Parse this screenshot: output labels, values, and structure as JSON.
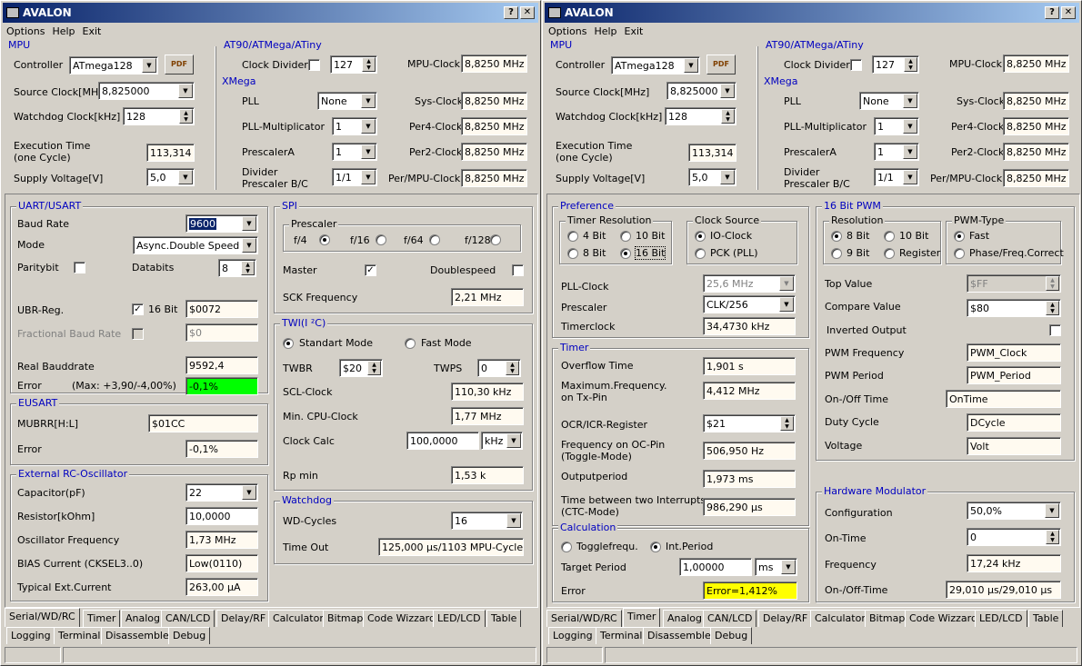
{
  "app": {
    "title": "AVALON",
    "help_btn": "?",
    "close_btn": "✕"
  },
  "menu": [
    "Options",
    "Help",
    "Exit"
  ],
  "mpu": {
    "title": "MPU",
    "controller_label": "Controller",
    "controller": "ATmega128",
    "source_clock_label": "Source Clock[MHz]",
    "source_clock": "8,825000",
    "watchdog_clock_label": "Watchdog Clock[kHz]",
    "watchdog_clock": "128",
    "exec_time_label1": "Execution Time",
    "exec_time_label2": "(one Cycle)",
    "exec_time": "113,314",
    "supply_label": "Supply Voltage[V]",
    "supply": "5,0"
  },
  "at90": {
    "title": "AT90/ATMega/ATiny",
    "clock_divider_label": "Clock Divider",
    "clock_divider": "127",
    "mpu_clock_label": "MPU-Clock",
    "mpu_clock": "8,8250 MHz"
  },
  "xmega": {
    "title": "XMega",
    "pll_label": "PLL",
    "pll": "None",
    "sys_clock_label": "Sys-Clock",
    "sys_clock": "8,8250 MHz",
    "pll_mult_label": "PLL-Multiplicator",
    "pll_mult": "1",
    "per4_label": "Per4-Clock",
    "per4": "8,8250 MHz",
    "prescalerA_label": "PrescalerA",
    "prescalerA": "1",
    "per2_label": "Per2-Clock",
    "per2": "8,8250 MHz",
    "divider_label1": "Divider",
    "divider_label2": "Prescaler B/C",
    "divider": "1/1",
    "permpu_label": "Per/MPU-Clock",
    "permpu": "8,8250 MHz"
  },
  "uart": {
    "title": "UART/USART",
    "baud_label": "Baud Rate",
    "baud": "9600",
    "mode_label": "Mode",
    "mode": "Async.Double Speed",
    "parity_label": "Paritybit",
    "databits_label": "Databits",
    "databits": "8",
    "ubr_label": "UBR-Reg.",
    "bit16_label": "16 Bit",
    "ubr": "$0072",
    "frac_label": "Fractional Baud Rate",
    "frac": "$0",
    "real_label": "Real Bauddrate",
    "real": "9592,4",
    "error_label": "Error",
    "error_range": "(Max: +3,90/-4,00%)",
    "error": "-0,1%"
  },
  "eusart": {
    "title": "EUSART",
    "mubrr_label": "MUBRR[H:L]",
    "mubrr": "$01CC",
    "error_label": "Error",
    "error": "-0,1%"
  },
  "rc": {
    "title": "External RC-Oscillator",
    "cap_label": "Capacitor(pF)",
    "cap": "22",
    "res_label": "Resistor[kOhm]",
    "res": "10,0000",
    "osc_label": "Oscillator Frequency",
    "osc": "1,73 MHz",
    "bias_label": "BIAS Current (CKSEL3..0)",
    "bias": "Low(0110)",
    "typ_label": "Typical Ext.Current",
    "typ": "263,00 µA"
  },
  "spi": {
    "title": "SPI",
    "prescaler_label": "Prescaler",
    "opts": [
      "f/4",
      "f/16",
      "f/64",
      "f/128"
    ],
    "master_label": "Master",
    "doublespeed_label": "Doublespeed",
    "sck_label": "SCK Frequency",
    "sck": "2,21 MHz"
  },
  "twi": {
    "title": "TWI(I ²C)",
    "std": "Standart Mode",
    "fast": "Fast Mode",
    "twbr_label": "TWBR",
    "twbr": "$20",
    "twps_label": "TWPS",
    "twps": "0",
    "scl_label": "SCL-Clock",
    "scl": "110,30 kHz",
    "mincpu_label": "Min. CPU-Clock",
    "mincpu": "1,77 MHz",
    "calc_label": "Clock Calc",
    "calc": "100,0000",
    "calc_unit": "kHz",
    "rp_label": "Rp min",
    "rp": "1,53 k"
  },
  "wd": {
    "title": "Watchdog",
    "cycles_label": "WD-Cycles",
    "cycles": "16",
    "timeout_label": "Time Out",
    "timeout": "125,000 µs/1103 MPU-Cycles"
  },
  "tabs_row1": [
    "Serial/WD/RC",
    "Timer",
    "Analog",
    "CAN/LCD",
    "Delay/RF",
    "Calculator",
    "Bitmap",
    "Code Wizzard",
    "LED/LCD",
    "Table"
  ],
  "tabs_row2": [
    "Logging",
    "Terminal",
    "Disassembler",
    "Debug"
  ],
  "pref": {
    "title": "Preference",
    "res_title": "Timer Resolution",
    "res_opts": [
      "4 Bit",
      "10 Bit",
      "8 Bit",
      "16 Bit"
    ],
    "src_title": "Clock Source",
    "src_opts": [
      "IO-Clock",
      "PCK (PLL)"
    ],
    "pll_label": "PLL-Clock",
    "pll": "25,6 MHz",
    "presc_label": "Prescaler",
    "presc": "CLK/256",
    "timerclock_label": "Timerclock",
    "timerclock": "34,4730 kHz"
  },
  "timer": {
    "title": "Timer",
    "ovf_label": "Overflow Time",
    "ovf": "1,901 s",
    "maxf_label1": "Maximum.Frequency.",
    "maxf_label2": "on Tx-Pin",
    "maxf": "4,412 MHz",
    "ocr_label": "OCR/ICR-Register",
    "ocr": "$21",
    "focpin_label1": "Frequency on OC-Pin",
    "focpin_label2": "(Toggle-Mode)",
    "focpin": "506,950 Hz",
    "outp_label": "Outputperiod",
    "outp": "1,973 ms",
    "tbi_label1": "Time between two Interrupts",
    "tbi_label2": "(CTC-Mode)",
    "tbi": "986,290 µs"
  },
  "calc": {
    "title": "Calculation",
    "toggle": "Togglefrequ.",
    "intp": "Int.Period",
    "target_label": "Target Period",
    "target": "1,00000",
    "target_unit": "ms",
    "error_label": "Error",
    "error": "Error=1,412%"
  },
  "pwm": {
    "title": "16 Bit PWM",
    "res_title": "Resolution",
    "res_opts": [
      "8 Bit",
      "10 Bit",
      "9 Bit",
      "Register"
    ],
    "type_title": "PWM-Type",
    "type_opts": [
      "Fast",
      "Phase/Freq.Correct"
    ],
    "top_label": "Top Value",
    "top": "$FF",
    "cmp_label": "Compare Value",
    "cmp": "$80",
    "inv_label": "Inverted Output",
    "freq_label": "PWM Frequency",
    "freq": "PWM_Clock",
    "period_label": "PWM Period",
    "period": "PWM_Period",
    "onoff_label": "On-/Off Time",
    "onoff": "OnTime",
    "duty_label": "Duty Cycle",
    "duty": "DCycle",
    "volt_label": "Voltage",
    "volt": "Volt"
  },
  "hwmod": {
    "title": "Hardware Modulator",
    "conf_label": "Configuration",
    "conf": "50,0%",
    "on_label": "On-Time",
    "on": "0",
    "freq_label": "Frequency",
    "freq": "17,24 kHz",
    "onoff_label": "On-/Off-Time",
    "onoff": "29,010 µs/29,010 µs"
  }
}
